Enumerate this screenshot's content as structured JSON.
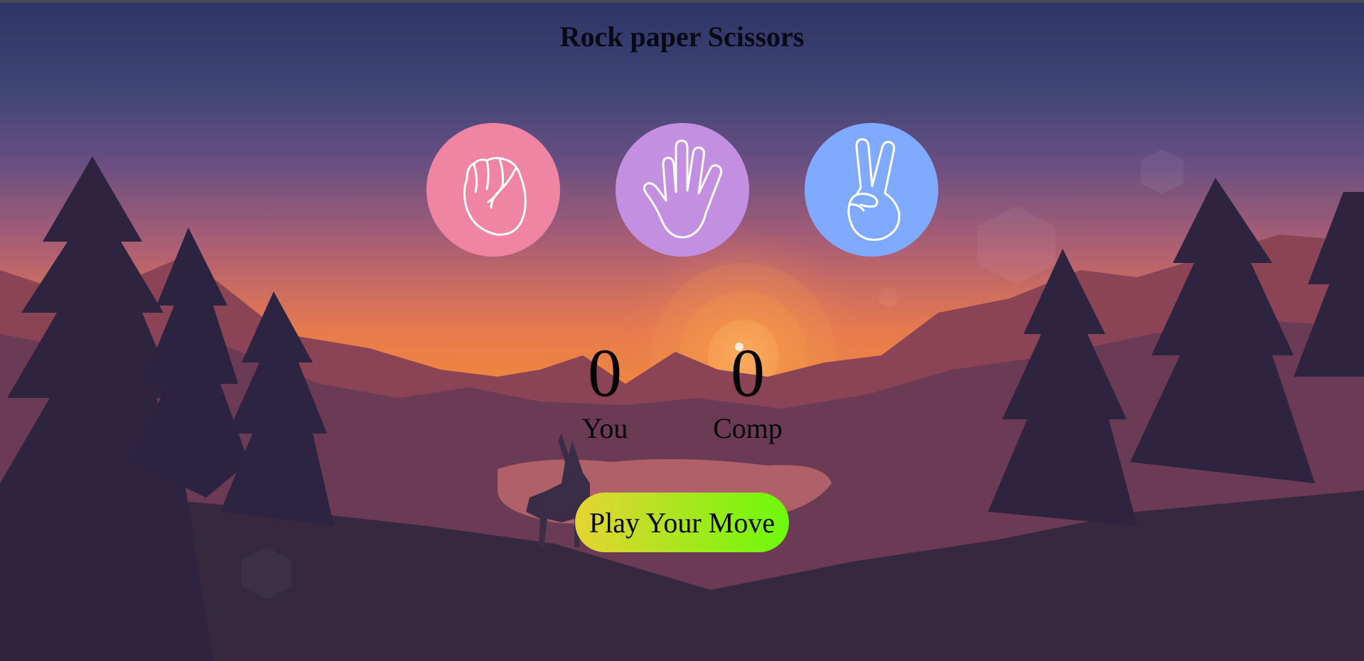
{
  "title": "Rock paper Scissors",
  "choices": [
    {
      "id": "rock",
      "icon": "fist-icon",
      "color": "#f084a3"
    },
    {
      "id": "paper",
      "icon": "open-hand-icon",
      "color": "#c38fe0"
    },
    {
      "id": "scissors",
      "icon": "peace-hand-icon",
      "color": "#80aaff"
    }
  ],
  "scoreboard": {
    "you": {
      "score": "0",
      "label": "You"
    },
    "comp": {
      "score": "0",
      "label": "Comp"
    }
  },
  "play_button": {
    "label": "Play Your Move",
    "gradient_start": "#e6d433",
    "gradient_end": "#6cf90a"
  }
}
